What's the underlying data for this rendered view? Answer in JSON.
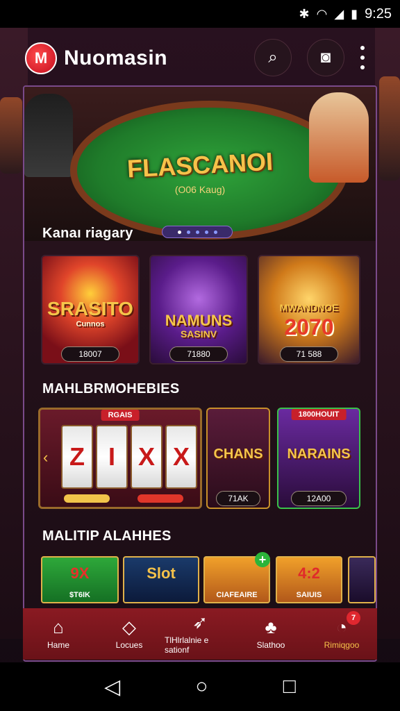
{
  "status": {
    "time": "9:25",
    "icons": [
      "bluetooth-icon",
      "wifi-icon",
      "signal-icon",
      "battery-icon"
    ]
  },
  "header": {
    "logo_letter": "M",
    "app_name": "Nuomasin"
  },
  "banner": {
    "title": "FLASCANOI",
    "subtitle": "(O06 Kaug)"
  },
  "section1": {
    "title": "Kanaı riagary",
    "cards": [
      {
        "name": "SRASITO",
        "sub": "Cunnos",
        "value": "18007"
      },
      {
        "name": "NAMUNS",
        "sub": "SASINV",
        "value": "71880"
      },
      {
        "name": "MWANDNOE",
        "sub": "2070",
        "value": "71 588"
      }
    ]
  },
  "section2": {
    "title": "MAHLBRMOHEBIES",
    "slot": {
      "ribbon": "RGAIS",
      "reels": [
        "Z",
        "I",
        "X",
        "X"
      ]
    },
    "cards": [
      {
        "name": "CHANS",
        "value": "71AK"
      },
      {
        "name": "NARAINS",
        "ribbon": "1800HOUIT",
        "value": "12A00"
      }
    ]
  },
  "section3": {
    "title": "MALITIP ALAHHES",
    "cards": [
      {
        "big": "9X",
        "label": "$T6IK"
      },
      {
        "big": "Slot",
        "label": ""
      },
      {
        "big": "",
        "label": "CIAFEAIRE"
      },
      {
        "big": "4:2",
        "label": "SAIUIS"
      },
      {
        "big": "",
        "label": ""
      }
    ]
  },
  "tabs": [
    {
      "label": "Hame",
      "icon": "home-icon"
    },
    {
      "label": "Locues",
      "icon": "diamond-icon"
    },
    {
      "label": "TlHlrlalnie e sationf",
      "icon": "rocket-icon"
    },
    {
      "label": "Slathoo",
      "icon": "people-icon"
    },
    {
      "label": "Rimiqgoo",
      "icon": "chat-icon",
      "badge": "7"
    }
  ],
  "colors": {
    "accent": "#f5c24a",
    "tabbar": "#8a1a22",
    "panel_border": "#7a4a8a"
  }
}
